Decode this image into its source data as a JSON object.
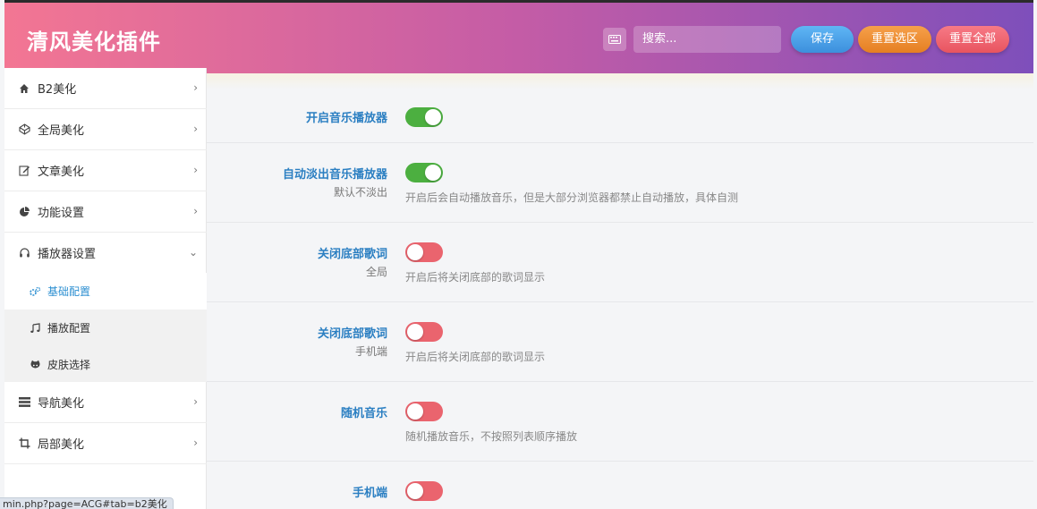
{
  "header": {
    "title": "清风美化插件",
    "search_placeholder": "搜索...",
    "save_label": "保存",
    "reset_section_label": "重置选区",
    "reset_all_label": "重置全部"
  },
  "sidebar": {
    "items": [
      {
        "label": "B2美化",
        "icon": "home-icon"
      },
      {
        "label": "全局美化",
        "icon": "codepen-icon"
      },
      {
        "label": "文章美化",
        "icon": "edit-icon"
      },
      {
        "label": "功能设置",
        "icon": "pie-chart-icon"
      },
      {
        "label": "播放器设置",
        "icon": "headphones-icon"
      },
      {
        "label": "导航美化",
        "icon": "navicon-icon"
      },
      {
        "label": "局部美化",
        "icon": "crop-icon"
      }
    ],
    "sub_items": [
      {
        "label": "基础配置",
        "icon": "gears-icon",
        "active": true
      },
      {
        "label": "播放配置",
        "icon": "music-icon",
        "active": false
      },
      {
        "label": "皮肤选择",
        "icon": "github-icon",
        "active": false
      }
    ]
  },
  "settings": [
    {
      "label": "开启音乐播放器",
      "sublabel": "",
      "on": true,
      "desc": ""
    },
    {
      "label": "自动淡出音乐播放器",
      "sublabel": "默认不淡出",
      "on": true,
      "desc": "开启后会自动播放音乐，但是大部分浏览器都禁止自动播放，具体自测"
    },
    {
      "label": "关闭底部歌词",
      "sublabel": "全局",
      "on": false,
      "desc": "开启后将关闭底部的歌词显示"
    },
    {
      "label": "关闭底部歌词",
      "sublabel": "手机端",
      "on": false,
      "desc": "开启后将关闭底部的歌词显示"
    },
    {
      "label": "随机音乐",
      "sublabel": "",
      "on": false,
      "desc": "随机播放音乐，不按照列表顺序播放"
    },
    {
      "label": "手机端",
      "sublabel": "",
      "on": false,
      "desc": ""
    }
  ],
  "status_bar": {
    "url": "min.php?page=ACG#tab=b2美化"
  },
  "colors": {
    "switch_on": "#4caf40",
    "switch_off": "#ea646e",
    "label_blue": "#2b7fc2"
  }
}
